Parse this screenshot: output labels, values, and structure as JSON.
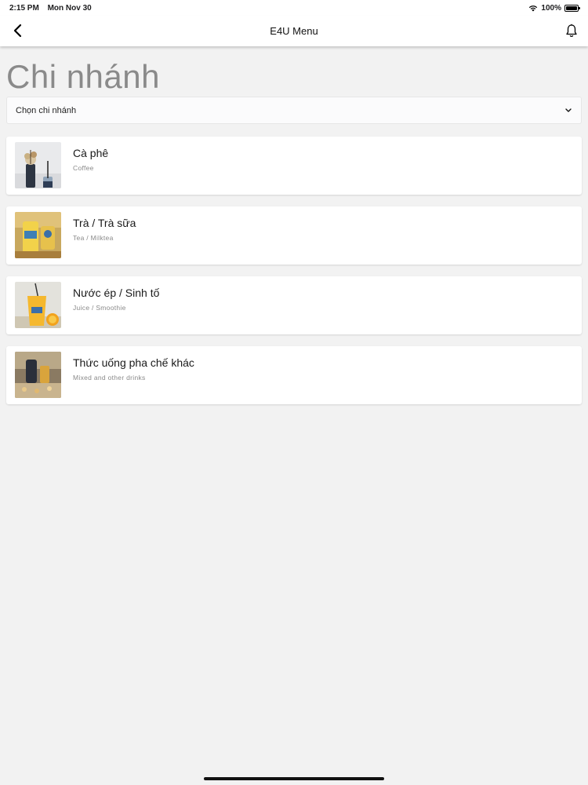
{
  "status_bar": {
    "time": "2:15 PM",
    "date": "Mon Nov 30",
    "battery": "100%"
  },
  "nav": {
    "title": "E4U Menu",
    "back_icon": "chevron-left-icon",
    "bell_icon": "bell-icon"
  },
  "page": {
    "title": "Chi nhánh"
  },
  "branch_select": {
    "label": "Chọn chi nhánh",
    "icon": "chevron-down-icon"
  },
  "categories": [
    {
      "name": "Cà phê",
      "sub": "Coffee"
    },
    {
      "name": "Trà / Trà sữa",
      "sub": "Tea / Milktea"
    },
    {
      "name": "Nước ép / Sinh tố",
      "sub": "Juice / Smoothie"
    },
    {
      "name": "Thức uống pha chế khác",
      "sub": "Mixed and other drinks"
    }
  ],
  "colors": {
    "background": "#f2f2f2",
    "card": "#ffffff",
    "title_gray": "#8a8a8a"
  }
}
